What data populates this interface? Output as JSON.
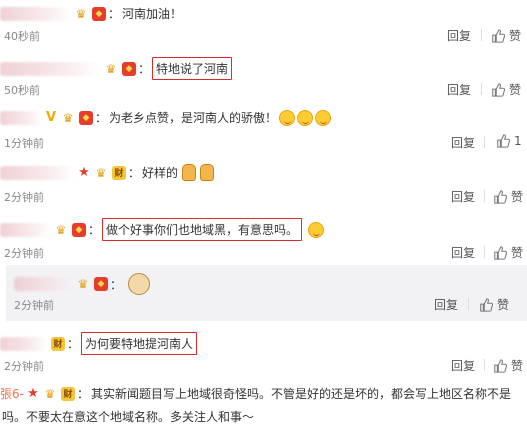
{
  "comments": [
    {
      "text": "河南加油！",
      "time": "40秒前",
      "reply": "回复",
      "like": "赞"
    },
    {
      "text": "特地说了河南",
      "time": "50秒前",
      "reply": "回复",
      "like": "赞"
    },
    {
      "text": "为老乡点赞，是河南人的骄傲！",
      "time": "1分钟前",
      "reply": "回复",
      "like": "1"
    },
    {
      "text": "好样的",
      "time": "2分钟前",
      "reply": "回复",
      "like": "赞",
      "badge": "财"
    },
    {
      "text": "做个好事你们也地域黑，有意思吗。",
      "time": "2分钟前",
      "reply": "回复",
      "like": "赞"
    },
    {
      "time": "2分钟前",
      "reply": "回复",
      "like": "赞"
    },
    {
      "text": "为何要特地提河南人",
      "time": "2分钟前",
      "reply": "回复",
      "like": "赞",
      "badge": "财"
    },
    {
      "username": "張6-",
      "badge": "财",
      "text_line1": "其实新闻题目写上地域很奇怪吗。不管是好的还是坏的，都会写上地区名称不是",
      "text_line2": "吗。不要太在意这个地域名称。多关注人和事～"
    }
  ],
  "colors": {
    "highlight_border": "#d92b2b",
    "username_orange": "#eb7350",
    "time_gray": "#888888"
  }
}
